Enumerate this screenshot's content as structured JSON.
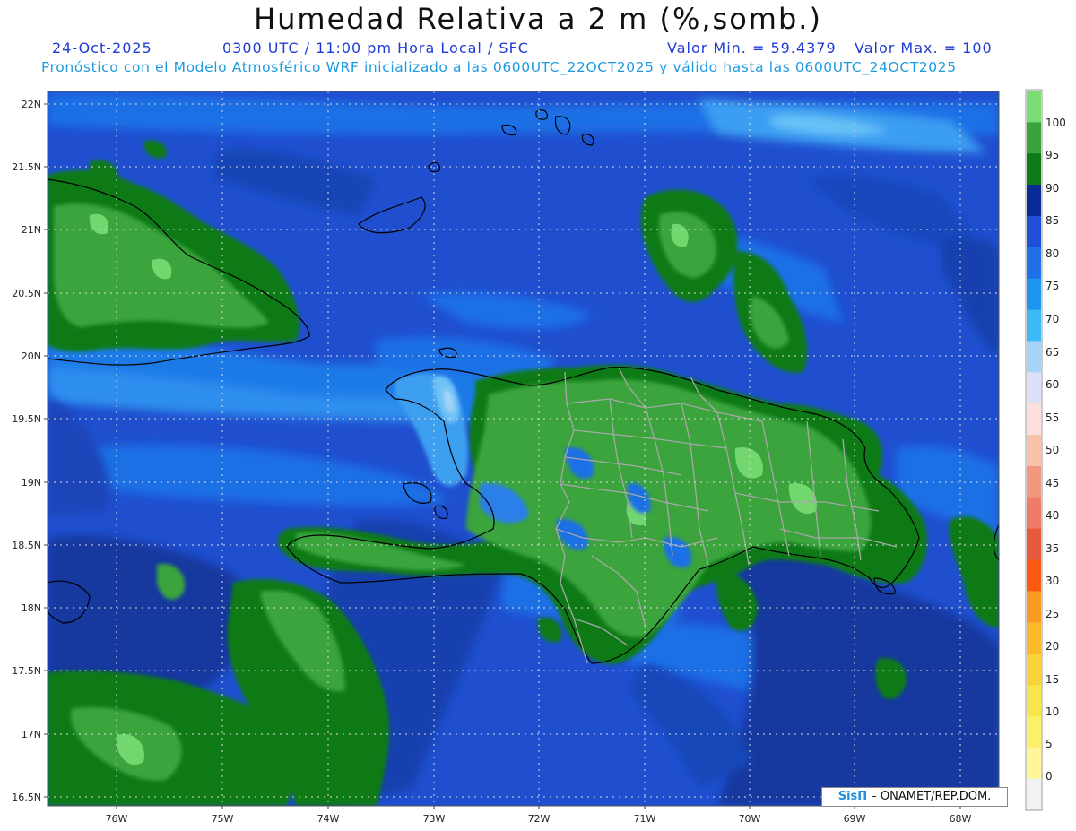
{
  "header": {
    "title": "Humedad Relativa a 2 m (%,somb.)",
    "date": "24-Oct-2025",
    "time": "0300 UTC / 11:00 pm Hora Local / SFC",
    "min_label": "Valor Min. = 59.4379",
    "max_label": "Valor Max. = 100",
    "subtitle": "Pronóstico con el Modelo Atmosférico WRF inicializado a las 0600UTC_22OCT2025 y válido hasta las  0600UTC_24OCT2025"
  },
  "stats": {
    "min": 59.4379,
    "max": 100
  },
  "axes": {
    "lat_labels": [
      "22N",
      "21.5N",
      "21N",
      "20.5N",
      "20N",
      "19.5N",
      "19N",
      "18.5N",
      "18N",
      "17.5N",
      "17N",
      "16.5N"
    ],
    "lon_labels": [
      "76W",
      "75W",
      "74W",
      "73W",
      "72W",
      "71W",
      "70W",
      "69W",
      "68W"
    ],
    "lat_range": [
      16.4,
      22.1
    ],
    "lon_range": [
      -76.65,
      -67.6
    ],
    "grid": true
  },
  "colorbar": {
    "labels": [
      "0",
      "5",
      "10",
      "15",
      "20",
      "25",
      "30",
      "35",
      "40",
      "45",
      "50",
      "55",
      "60",
      "65",
      "70",
      "75",
      "80",
      "85",
      "90",
      "95",
      "100"
    ],
    "colors": [
      "#f2f2f2",
      "#fff797",
      "#fcef6a",
      "#f7e64b",
      "#f7d23a",
      "#f9b92b",
      "#fb9a22",
      "#fb5a10",
      "#e85a3e",
      "#ee7c66",
      "#f1987e",
      "#f8c1a9",
      "#fde0dd",
      "#dbe0f6",
      "#a6d3f8",
      "#3ebbf6",
      "#1e95ee",
      "#1f70e8",
      "#1e4fd4",
      "#0b2a97",
      "#0d7a15",
      "#3aa43c",
      "#79dd74"
    ]
  },
  "credit": {
    "brand": "SisΠ",
    "org": " – ONAMET/REP.DOM."
  }
}
